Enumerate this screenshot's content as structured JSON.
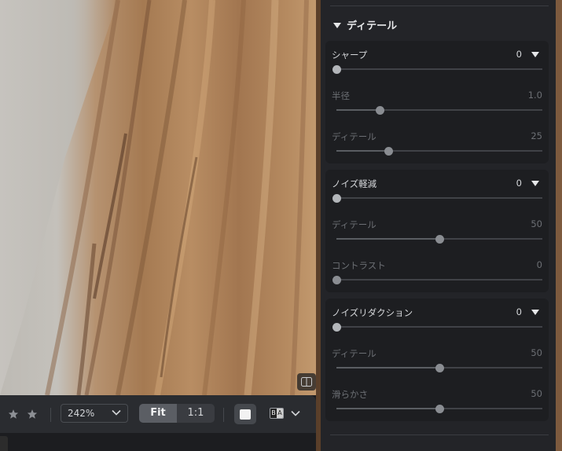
{
  "toolbar": {
    "zoom_value": "242%",
    "fit_label": "Fit",
    "one_to_one_label": "1:1",
    "ba_left": "B",
    "ba_right": "A"
  },
  "panel": {
    "section_title": "ディテール",
    "groups": [
      {
        "label": "シャープ",
        "value": "0",
        "level": 0,
        "subs": [
          {
            "label": "半径",
            "value": "1.0",
            "level": 0.21
          },
          {
            "label": "ディテール",
            "value": "25",
            "level": 0.25
          }
        ]
      },
      {
        "label": "ノイズ軽減",
        "value": "0",
        "level": 0,
        "subs": [
          {
            "label": "ディテール",
            "value": "50",
            "level": 0.5
          },
          {
            "label": "コントラスト",
            "value": "0",
            "level": 0
          }
        ]
      },
      {
        "label": "ノイズリダクション",
        "value": "0",
        "level": 0,
        "subs": [
          {
            "label": "ディテール",
            "value": "50",
            "level": 0.5
          },
          {
            "label": "滑らかさ",
            "value": "50",
            "level": 0.5
          }
        ]
      }
    ]
  },
  "colors": {
    "panel_bg": "#232428",
    "card_bg": "#1d1e21",
    "toolbar_bg": "#2a2c30",
    "active_segment": "#5b5e64"
  }
}
